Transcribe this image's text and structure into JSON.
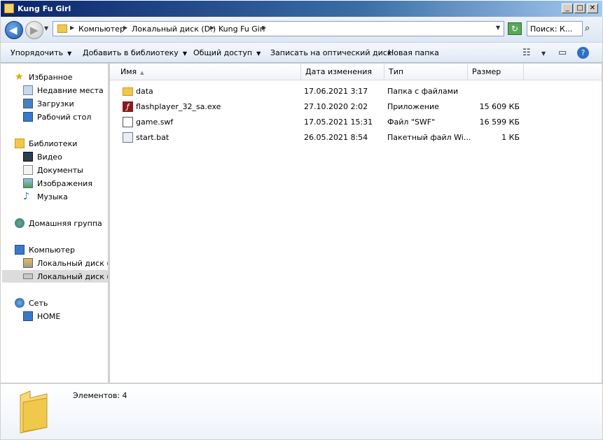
{
  "window": {
    "title": "Kung Fu Girl",
    "minimize_label": "_",
    "maximize_label": "□",
    "close_label": "✕"
  },
  "address": {
    "crumbs": [
      "Компьютер",
      "Локальный диск (D:)",
      "Kung Fu Girl"
    ],
    "search_text": "Поиск: К..."
  },
  "commands": {
    "organize": "Упорядочить",
    "add_to_library": "Добавить в библиотеку",
    "share": "Общий доступ",
    "burn": "Записать на оптический диск",
    "new_folder": "Новая папка"
  },
  "nav": {
    "favorites": "Избранное",
    "recent": "Недавние места",
    "downloads": "Загрузки",
    "desktop": "Рабочий стол",
    "libraries": "Библиотеки",
    "video": "Видео",
    "documents": "Документы",
    "images": "Изображения",
    "music": "Музыка",
    "homegroup": "Домашняя группа",
    "computer": "Компьютер",
    "disk_c": "Локальный диск (C:",
    "disk_d": "Локальный диск (D:",
    "network": "Сеть",
    "home": "HOME"
  },
  "columns": {
    "name": "Имя",
    "modified": "Дата изменения",
    "type": "Тип",
    "size": "Размер"
  },
  "files": [
    {
      "name": "data",
      "modified": "17.06.2021 3:17",
      "type": "Папка с файлами",
      "size": "",
      "icon": "folder-icon"
    },
    {
      "name": "flashplayer_32_sa.exe",
      "modified": "27.10.2020 2:02",
      "type": "Приложение",
      "size": "15 609 КБ",
      "icon": "flash-icon"
    },
    {
      "name": "game.swf",
      "modified": "17.05.2021 15:31",
      "type": "Файл \"SWF\"",
      "size": "16 599 КБ",
      "icon": "swf-file-icon"
    },
    {
      "name": "start.bat",
      "modified": "26.05.2021 8:54",
      "type": "Пакетный файл Wi...",
      "size": "1 КБ",
      "icon": "bat-file-icon"
    }
  ],
  "details": {
    "count_text": "Элементов: 4"
  }
}
